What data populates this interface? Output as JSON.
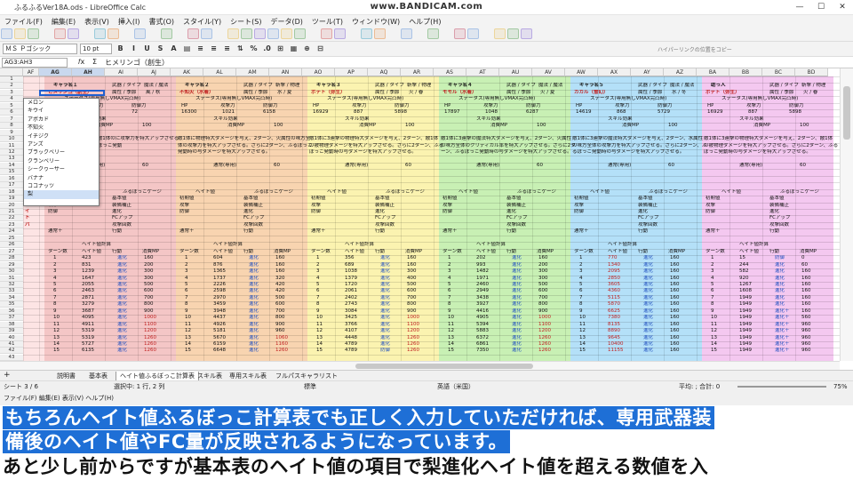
{
  "window": {
    "title": "ふるふるVer18A.ods - LibreOffice Calc",
    "watermark": "www.BANDICAM.com",
    "controls": [
      "—",
      "☐",
      "✕"
    ]
  },
  "menu": [
    "ファイル(F)",
    "編集(E)",
    "表示(V)",
    "挿入(I)",
    "書式(O)",
    "スタイル(Y)",
    "シート(S)",
    "データ(D)",
    "ツール(T)",
    "ウィンドウ(W)",
    "ヘルプ(H)"
  ],
  "toolbar": {
    "font_name": "ＭＳ Ｐゴシック",
    "font_size": "10 pt",
    "hyperlink_hint": "ハイパーリンクの位置をコピー"
  },
  "formula_bar": {
    "name_box": "AG3:AH3",
    "content": "ヒメリンゴ（創生）"
  },
  "columns": [
    "AF",
    "AG",
    "AH",
    "AI",
    "AJ",
    "AK",
    "AL",
    "AM",
    "AN",
    "AO",
    "AP",
    "AQ",
    "AR",
    "AS",
    "AT",
    "AU",
    "AV",
    "AW",
    "AX",
    "AY",
    "AZ",
    "BA",
    "BB",
    "BC",
    "BD"
  ],
  "rows": [
    "1",
    "2",
    "3",
    "4",
    "5",
    "6",
    "7",
    "8",
    "9",
    "10",
    "11",
    "12",
    "13",
    "14",
    "15",
    "16",
    "17",
    "18",
    "19",
    "20",
    "21",
    "22",
    "23",
    "24",
    "25",
    "26",
    "27",
    "28",
    "29",
    "30",
    "31",
    "32",
    "33",
    "34",
    "35",
    "36",
    "37",
    "38",
    "39",
    "40",
    "41",
    "42",
    "43"
  ],
  "char_blocks": [
    {
      "title": "キャラ名１",
      "name": "ヒメリンゴ（創生）",
      "weapon": "武器 / タイプ",
      "attr": "魔法 / 魔法",
      "season": "属性 / 季節",
      "season_val": "風 / 秋",
      "hp": "7191",
      "atk": "98",
      "def": "72",
      "color": "#f4c6c6"
    },
    {
      "title": "キャラ名２",
      "name": "不知火（水着）",
      "weapon": "武器 / タイプ",
      "attr": "斬撃 / 物理",
      "season": "属性 / 季節",
      "season_val": "水 / 夏",
      "hp": "16300",
      "atk": "1021",
      "def": "6158",
      "color": "#f8d4b0"
    },
    {
      "title": "キャラ名３",
      "name": "ポテト（弥生）",
      "weapon": "武器 / タイプ",
      "attr": "斬撃 / 物理",
      "season": "属性 / 季節",
      "season_val": "火 / 春",
      "hp": "16929",
      "atk": "887",
      "def": "5898",
      "color": "#fbf3b0"
    },
    {
      "title": "キャラ名４",
      "name": "モモル（水着）",
      "weapon": "武器 / タイプ",
      "attr": "魔法 / 魔法",
      "season": "属性 / 季節",
      "season_val": "火 / 夏",
      "hp": "17897",
      "atk": "1048",
      "def": "6287",
      "color": "#c8f0b4"
    },
    {
      "title": "キャラ名５",
      "name": "カカル（雪幻）",
      "weapon": "武器 / タイプ",
      "attr": "魔法 / 魔法",
      "season": "属性 / 季節",
      "season_val": "水 / 冬",
      "hp": "14619",
      "atk": "868",
      "def": "5729",
      "color": "#b4e0f8"
    },
    {
      "title": "助っ人",
      "name": "ポテト（弥生）",
      "weapon": "武器 / タイプ",
      "attr": "斬撃 / 物理",
      "season": "属性 / 季節",
      "season_val": "火 / 春",
      "hp": "16929",
      "atk": "887",
      "def": "5898",
      "color": "#f4c8f0"
    }
  ],
  "labels": {
    "status": "ステータス(専用無しVMAX完凸時)",
    "hp": "HP",
    "atk": "攻撃力",
    "def": "防御力",
    "skill": "スキル効果",
    "mp": "消費MP",
    "mp_val": "100",
    "sp": "通常(専用)",
    "sp_val": "60",
    "hate": "ヘイト値",
    "gauge": "ふるぼっこゲージ",
    "initial": "初期値",
    "base": "基本値",
    "attack": "攻撃",
    "ornament": "装備補正",
    "defense": "防御",
    "evolution": "進化",
    "fcup": "FCアップ",
    "attack_count": "攻撃回数",
    "normal_plus": "通常＋",
    "action": "行動",
    "calc": "ヘイト値計算",
    "turn": "ターン数",
    "hate_val": "ヘイト値",
    "evo": "進化",
    "attack_word": "攻撃",
    "defense_word": "防御",
    "evoplus": "進化＋"
  },
  "side_letters": "ヘイトバ",
  "skill_texts": [
    "ージを与え、2ターン、敵1体の\nに攻撃力を特大アップさせる。\nさらに2ターン、ふるぼっこ発動",
    "敵1体に物理特大ダメージを与え、2ターン、火属性の味方全体の攻撃力を特大アップさせる。さらに2ターン、ふるぼっこ発動時の与ダメージを特大アップさせる。",
    "敵1体に3連撃の物理特大ダメージを与え、2ターン、敵1体の被物理ダメージを特大アップさせる。さらに2ターン、ふるぼっこ発動時の与ダメージを特大アップさせる。",
    "敵1体に3連撃の魔法特大ダメージを与え、2ターン、火属性の味方全体のクリティカル率を特大アップさせる。さらに2ターン、ふるぼっこ発動時の与ダメージを特大アップさせる。",
    "敵1体に3連撃の魔法特大ダメージを与え、2ターン、水属性の味方全体の攻撃力を特大アップさせる。さらに2ターン、ふるぼっこ発動時の与ダメージを特大アップさせる。",
    "敵1体に3連撃の物理特大ダメージを与え、2ターン、敵1体の被物理ダメージを特大アップさせる。さらに2ターン、ふるぼっこ発動時の与ダメージを特大アップさせる。"
  ],
  "dropdown_options": [
    "メロン",
    "キウイ",
    "アボカド",
    "不知火",
    "イチジク",
    "アンズ",
    "ブラックベリー",
    "クランベリー",
    "シークヮーサー",
    "バナナ",
    "ココナッツ",
    "梨"
  ],
  "hate_rows": [
    [
      "1",
      "423",
      "進化",
      "160",
      "1",
      "604",
      "進化",
      "160",
      "1",
      "356",
      "進化",
      "160",
      "1",
      "202",
      "進化",
      "160",
      "1",
      "770",
      "進化",
      "160",
      "1",
      "15",
      "防御",
      "0"
    ],
    [
      "2",
      "831",
      "進化",
      "200",
      "2",
      "876",
      "進化",
      "160",
      "2",
      "689",
      "進化",
      "160",
      "2",
      "993",
      "進化",
      "200",
      "2",
      "1340",
      "進化",
      "160",
      "2",
      "244",
      "進化",
      "60"
    ],
    [
      "3",
      "1239",
      "進化",
      "300",
      "3",
      "1365",
      "進化",
      "160",
      "3",
      "1038",
      "進化",
      "300",
      "3",
      "1482",
      "進化",
      "300",
      "3",
      "2095",
      "進化",
      "160",
      "3",
      "582",
      "進化",
      "160"
    ],
    [
      "4",
      "1647",
      "進化",
      "300",
      "4",
      "1737",
      "進化",
      "320",
      "4",
      "1379",
      "進化",
      "400",
      "4",
      "1971",
      "進化",
      "300",
      "4",
      "2850",
      "進化",
      "160",
      "4",
      "920",
      "進化",
      "160"
    ],
    [
      "5",
      "2055",
      "進化",
      "500",
      "5",
      "2226",
      "進化",
      "420",
      "5",
      "1720",
      "進化",
      "500",
      "5",
      "2460",
      "進化",
      "500",
      "5",
      "3605",
      "進化",
      "160",
      "5",
      "1267",
      "進化",
      "160"
    ],
    [
      "6",
      "2463",
      "進化",
      "600",
      "6",
      "2598",
      "進化",
      "420",
      "6",
      "2061",
      "進化",
      "600",
      "6",
      "2949",
      "進化",
      "600",
      "6",
      "4360",
      "進化",
      "160",
      "6",
      "1608",
      "進化",
      "160"
    ],
    [
      "7",
      "2871",
      "進化",
      "700",
      "7",
      "2970",
      "進化",
      "500",
      "7",
      "2402",
      "進化",
      "700",
      "7",
      "3438",
      "進化",
      "700",
      "7",
      "5115",
      "進化",
      "160",
      "7",
      "1949",
      "進化",
      "160"
    ],
    [
      "8",
      "3279",
      "進化",
      "800",
      "8",
      "3459",
      "進化",
      "600",
      "8",
      "2743",
      "進化",
      "800",
      "8",
      "3927",
      "進化",
      "800",
      "8",
      "5870",
      "進化",
      "160",
      "8",
      "1949",
      "進化",
      "160"
    ],
    [
      "9",
      "3687",
      "進化",
      "900",
      "9",
      "3948",
      "進化",
      "700",
      "9",
      "3084",
      "進化",
      "900",
      "9",
      "4416",
      "進化",
      "900",
      "9",
      "6625",
      "進化",
      "160",
      "9",
      "1949",
      "進化＋",
      "160"
    ],
    [
      "10",
      "4095",
      "進化",
      "1000",
      "10",
      "4437",
      "進化",
      "800",
      "10",
      "3425",
      "進化",
      "1000",
      "10",
      "4905",
      "進化",
      "1000",
      "10",
      "7380",
      "進化",
      "160",
      "10",
      "1949",
      "進化＋",
      "560"
    ],
    [
      "11",
      "4911",
      "進化",
      "1100",
      "11",
      "4926",
      "進化",
      "900",
      "11",
      "3766",
      "進化",
      "1100",
      "11",
      "5394",
      "進化",
      "1100",
      "11",
      "8135",
      "進化",
      "160",
      "11",
      "1949",
      "進化＋",
      "960"
    ],
    [
      "12",
      "5319",
      "進化",
      "1200",
      "12",
      "5181",
      "進化",
      "960",
      "12",
      "4107",
      "進化",
      "1200",
      "12",
      "5883",
      "進化",
      "1200",
      "12",
      "8890",
      "進化",
      "160",
      "12",
      "1949",
      "進化＋",
      "960"
    ],
    [
      "13",
      "5319",
      "進化",
      "1260",
      "13",
      "5670",
      "進化",
      "1060",
      "13",
      "4448",
      "進化",
      "1260",
      "13",
      "6372",
      "進化",
      "1260",
      "13",
      "9645",
      "進化",
      "160",
      "13",
      "1949",
      "進化＋",
      "960"
    ],
    [
      "14",
      "5727",
      "進化",
      "1260",
      "14",
      "6159",
      "進化",
      "1160",
      "14",
      "4789",
      "進化",
      "1260",
      "14",
      "6861",
      "進化",
      "1260",
      "14",
      "10400",
      "進化",
      "160",
      "14",
      "1949",
      "進化＋",
      "960"
    ],
    [
      "15",
      "6135",
      "進化",
      "1260",
      "15",
      "6648",
      "進化",
      "1260",
      "15",
      "4789",
      "防御",
      "1260",
      "15",
      "7350",
      "進化",
      "1260",
      "15",
      "11155",
      "進化",
      "160",
      "15",
      "1949",
      "進化＋",
      "960"
    ]
  ],
  "sheet_tabs": [
    "説明書",
    "基本表",
    "ヘイト値ふるぼっこ計算表",
    "スキル表",
    "専用スキル表",
    "フルパスキャラリスト"
  ],
  "active_tab_index": 2,
  "status": {
    "sheet": "シート 3 / 6",
    "selection": "選択中: 1 行, 2 列",
    "style": "標準",
    "lang": "英語（米国）",
    "sum": "平均: ; 合計: 0",
    "zoom": "75%"
  },
  "status2": "ファイル(F)  編集(E)  表示(V)  ヘルプ(H)",
  "subtitles": [
    "もちろんヘイト値ふるぼっこ計算表でも正しく入力していただければ、専用武器装",
    "備後のヘイト値やFC量が反映されるようになっています。",
    "あと少し前からですが基本表のヘイト値の項目で梨進化ヘイト値を超える数値を入"
  ]
}
